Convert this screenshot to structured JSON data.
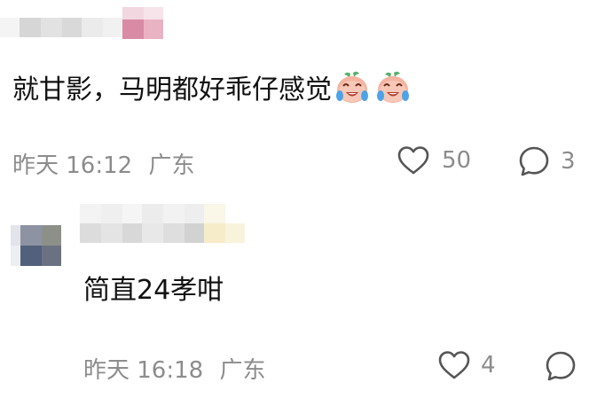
{
  "comments": [
    {
      "text": "就甘影，马明都好乖仔感觉",
      "emoji_icon": "crying-laughing-peach-icon",
      "time": "昨天 16:12",
      "location": "广东",
      "likes": "50",
      "replies": "3"
    },
    {
      "text": "简直24孝咁",
      "time": "昨天 16:18",
      "location": "广东",
      "likes": "4",
      "replies": ""
    }
  ],
  "icons": {
    "like": "heart-outline-icon",
    "reply": "speech-bubble-icon"
  },
  "colors": {
    "text": "#111111",
    "meta": "#8c8c8c",
    "icon": "#555555"
  }
}
